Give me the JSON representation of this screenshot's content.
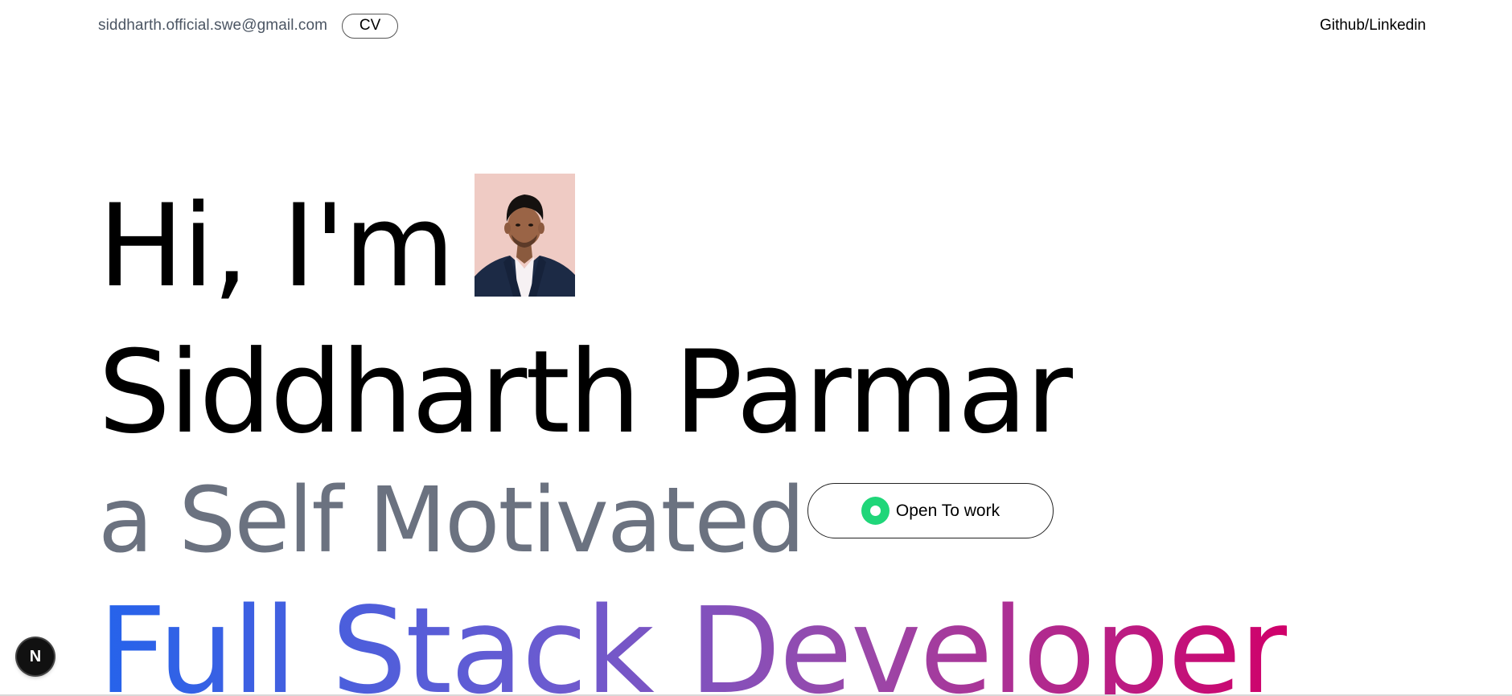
{
  "header": {
    "email": "siddharth.official.swe@gmail.com",
    "cv_label": "CV",
    "social_label": "Github/Linkedin"
  },
  "hero": {
    "greeting": "Hi, I'm",
    "name": "Siddharth Parmar",
    "tagline": "a Self Motivated",
    "role": "Full Stack Developer",
    "status_label": "Open To work",
    "status_color": "#1fd679"
  },
  "dev_badge": {
    "label": "N"
  },
  "colors": {
    "role_gradient_start": "#2563eb",
    "role_gradient_mid": "#9b47a8",
    "role_gradient_end": "#d0006a",
    "tagline": "#6b7280",
    "email": "#4b5563"
  },
  "icons": {
    "status": "status-dot-icon",
    "avatar": "profile-photo"
  }
}
